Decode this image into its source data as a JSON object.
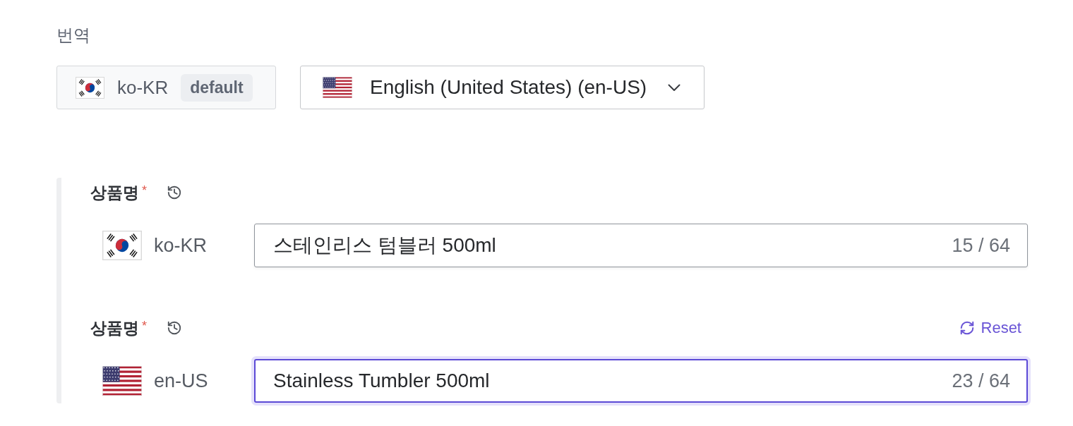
{
  "section_title": "번역",
  "languages": {
    "default": {
      "kind": "kr",
      "code": "ko-KR",
      "badge": "default"
    },
    "selector": {
      "kind": "us",
      "label": "English (United States) (en-US)"
    }
  },
  "fields": [
    {
      "label": "상품명",
      "required_mark": "*",
      "locale": {
        "kind": "kr",
        "code": "ko-KR"
      },
      "value": "스테인리스 텀블러 500ml",
      "counter": "15 / 64",
      "focused": false
    },
    {
      "label": "상품명",
      "required_mark": "*",
      "reset": "Reset",
      "locale": {
        "kind": "us",
        "code": "en-US"
      },
      "value": "Stainless Tumbler 500ml",
      "counter": "23 / 64",
      "focused": true
    }
  ]
}
